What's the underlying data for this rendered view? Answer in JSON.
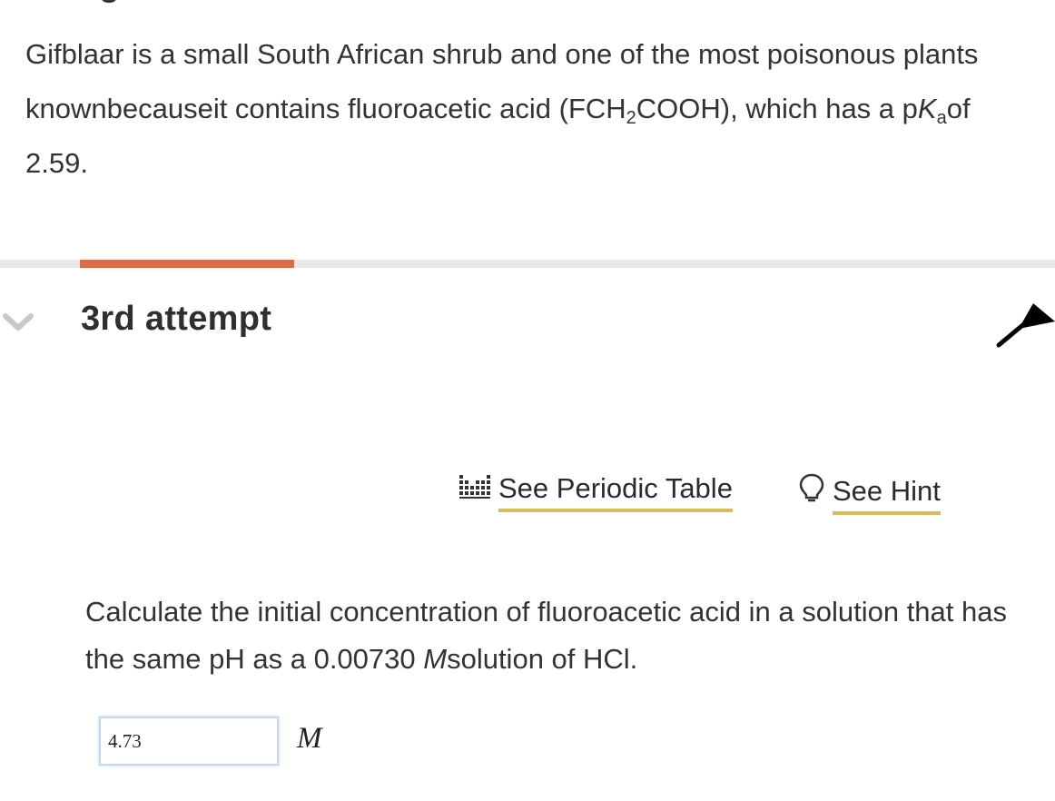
{
  "intro": {
    "part1": "Gifblaar is a small South African shrub and one of the most poisonous plants knownbecauseit contains fluoroacetic acid (FCH",
    "sub2": "2",
    "part2": "COOH), which has a p",
    "ka_letter": "K",
    "ka_sub": "a",
    "part3": "of 2.59."
  },
  "progress": {
    "fraction": 0.2,
    "fill_color": "#dd6b4d",
    "track_color": "#e9e9e9"
  },
  "attempt": {
    "title": "3rd attempt",
    "chevron_icon": "chevron-down-icon"
  },
  "links": {
    "periodic_table": "See Periodic Table",
    "periodic_icon": "periodic-table-icon",
    "hint": "See Hint",
    "hint_icon": "lightbulb-icon",
    "underline_color": "#d9bc5a"
  },
  "question": {
    "part1": "Calculate the initial concentration of fluoroacetic acid in a solution that has the same pH as a 0.00730 ",
    "unit_italic": "M",
    "part2": "solution of HCl."
  },
  "answer": {
    "value": "4.73",
    "unit": "M"
  }
}
